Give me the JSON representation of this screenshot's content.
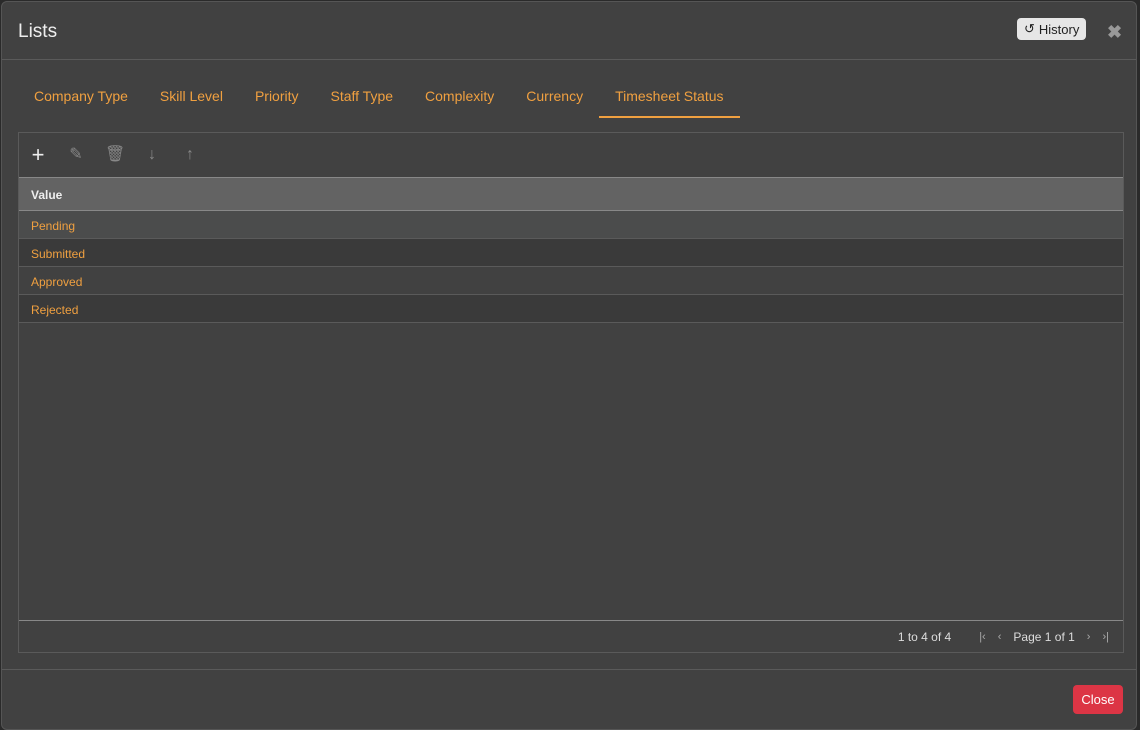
{
  "dialog": {
    "title": "Lists",
    "history_label": "History",
    "close_label": "Close"
  },
  "tabs": [
    "Company Type",
    "Skill Level",
    "Priority",
    "Staff Type",
    "Complexity",
    "Currency",
    "Timesheet Status"
  ],
  "active_tab": "Timesheet Status",
  "grid": {
    "column": "Value",
    "rows": [
      "Pending",
      "Submitted",
      "Approved",
      "Rejected"
    ],
    "pager": {
      "summary": "1 to 4 of 4",
      "page": "Page 1 of 1"
    }
  }
}
